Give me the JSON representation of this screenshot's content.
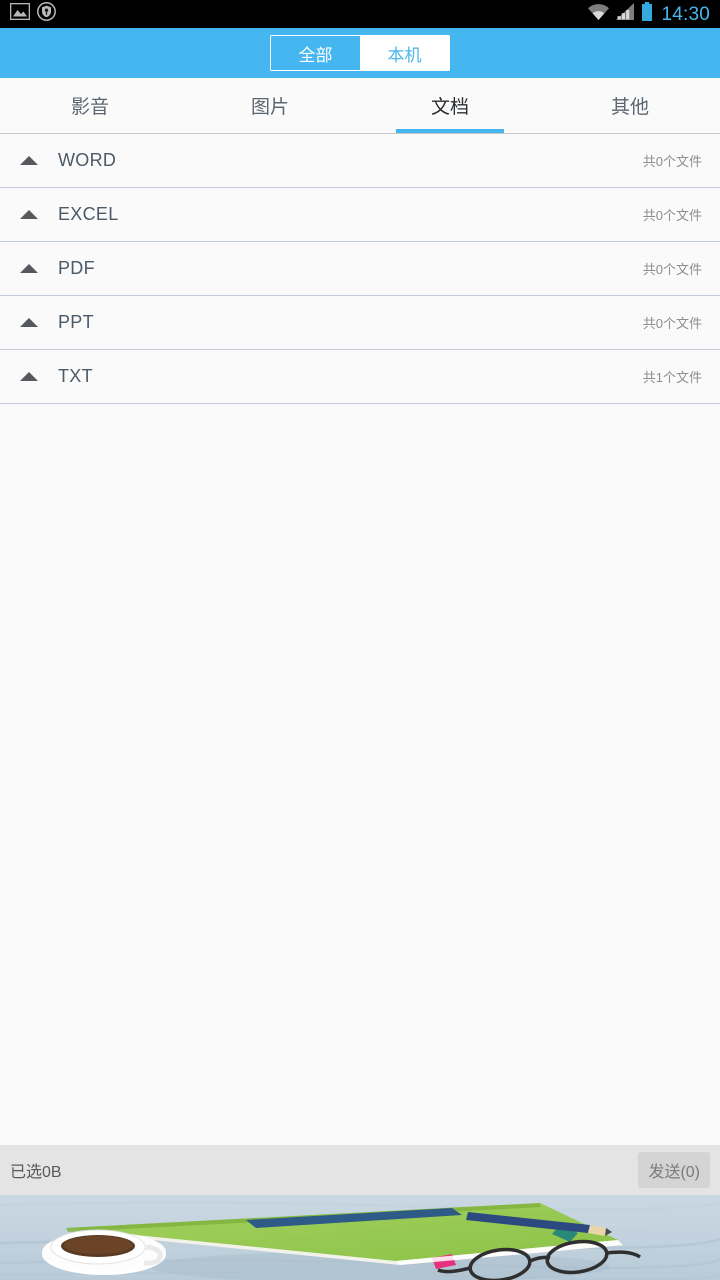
{
  "status_bar": {
    "icons_left": [
      "image-icon",
      "shield-location-icon"
    ],
    "icons_right": [
      "wifi-icon",
      "signal-icon",
      "battery-icon"
    ],
    "clock": "14:30",
    "clock_color": "#49b6ec",
    "background": "#000000"
  },
  "header": {
    "background": "#45b6f0",
    "segments": [
      {
        "label": "全部",
        "active": true
      },
      {
        "label": "本机",
        "active": false
      }
    ]
  },
  "tabs": [
    {
      "label": "影音",
      "active": false
    },
    {
      "label": "图片",
      "active": false
    },
    {
      "label": "文档",
      "active": true
    },
    {
      "label": "其他",
      "active": false
    }
  ],
  "tab_accent_color": "#45b6f0",
  "list": {
    "rows": [
      {
        "icon": "triangle-up-icon",
        "label": "WORD",
        "count": "共0个文件"
      },
      {
        "icon": "triangle-up-icon",
        "label": "EXCEL",
        "count": "共0个文件"
      },
      {
        "icon": "triangle-up-icon",
        "label": "PDF",
        "count": "共0个文件"
      },
      {
        "icon": "triangle-up-icon",
        "label": "PPT",
        "count": "共0个文件"
      },
      {
        "icon": "triangle-up-icon",
        "label": "TXT",
        "count": "共1个文件"
      }
    ]
  },
  "bottom_bar": {
    "selected_label": "已选0B",
    "send_label": "发送(0)",
    "background": "#e4e4e4"
  },
  "wallpaper": {
    "description": "desk-scene-wallpaper",
    "colors": {
      "desk": "#c5d3de",
      "notebook": "#96cc55",
      "notebook_band": "#2d5a86",
      "cup": "#ffffff",
      "coffee": "#5a3a22",
      "pencil": "#2d4a80",
      "glasses": "#2a2a2a"
    }
  }
}
